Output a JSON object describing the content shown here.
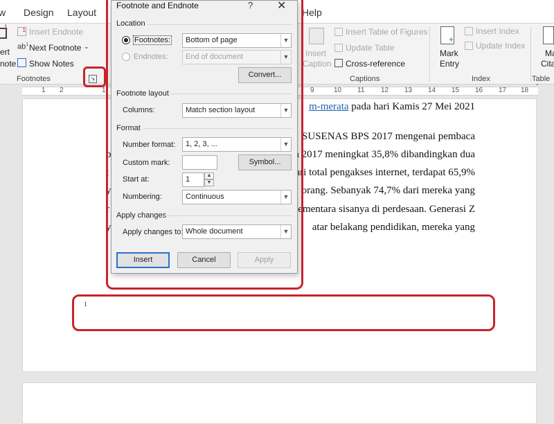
{
  "tabs": [
    "w",
    "Design",
    "Layout",
    "Help"
  ],
  "ribbon": {
    "footnotes": {
      "insert_endnote": "Insert Endnote",
      "next_footnote": "Next Footnote",
      "show_notes": "Show Notes",
      "partial_top": "ert",
      "partial_bottom": "note",
      "group_label": "Footnotes"
    },
    "captions": {
      "insert_label_line1": "Insert",
      "insert_label_line2": "Caption",
      "insert_table_of_figures": "Insert Table of Figures",
      "update_table": "Update Table",
      "cross_reference": "Cross-reference",
      "group_label": "Captions"
    },
    "index": {
      "mark_entry_line1": "Mark",
      "mark_entry_line2": "Entry",
      "insert_index": "Insert Index",
      "update_index": "Update Index",
      "group_label": "Index"
    },
    "right_partial": {
      "line1": "Ma",
      "line2": "Cita",
      "group_label": "Table of"
    }
  },
  "ruler": {
    "numbers": [
      "1",
      "2",
      "1",
      "2",
      "3",
      "4",
      "5",
      "6",
      "7",
      "8",
      "9",
      "10",
      "11",
      "12",
      "13",
      "14",
      "15",
      "16",
      "17",
      "18"
    ]
  },
  "document": {
    "line1_link": "m-merata",
    "line1_rest": " pada hari Kamis 27 Mei 2021",
    "lines": [
      "SUSENAS BPS 2017 mengenai pembaca",
      "a 2017 meningkat 35,8% dibandingkan dua",
      "Dari total pengakses internet, terdapat 65,9%",
      "orang. Sebanyak 74,7% dari mereka yang",
      "ementara sisanya di perdesaan. Generasi Z",
      "atar belakang pendidikan, mereka yang"
    ],
    "left_fragments": [
      "b",
      "t",
      "y",
      "r",
      "y"
    ],
    "footnote_number": "1"
  },
  "dialog": {
    "title": "Footnote and Endnote",
    "help": "?",
    "close": "✕",
    "location_label": "Location",
    "footnotes_label": "Footnotes:",
    "footnotes_value": "Bottom of page",
    "endnotes_label": "Endnotes:",
    "endnotes_value": "End of document",
    "convert_button": "Convert...",
    "footnote_layout_label": "Footnote layout",
    "columns_label": "Columns:",
    "columns_value": "Match section layout",
    "format_label": "Format",
    "number_format_label": "Number format:",
    "number_format_value": "1, 2, 3, ...",
    "custom_mark_label": "Custom mark:",
    "custom_mark_value": "",
    "symbol_button": "Symbol...",
    "start_at_label": "Start at:",
    "start_at_value": "1",
    "numbering_label": "Numbering:",
    "numbering_value": "Continuous",
    "apply_changes_section": "Apply changes",
    "apply_changes_to_label": "Apply changes to:",
    "apply_changes_to_value": "Whole document",
    "insert_button": "Insert",
    "cancel_button": "Cancel",
    "apply_button": "Apply"
  },
  "colors": {
    "highlight": "#c8232c",
    "link": "#1f5fa8",
    "primary_button_border": "#2a6fc9"
  }
}
